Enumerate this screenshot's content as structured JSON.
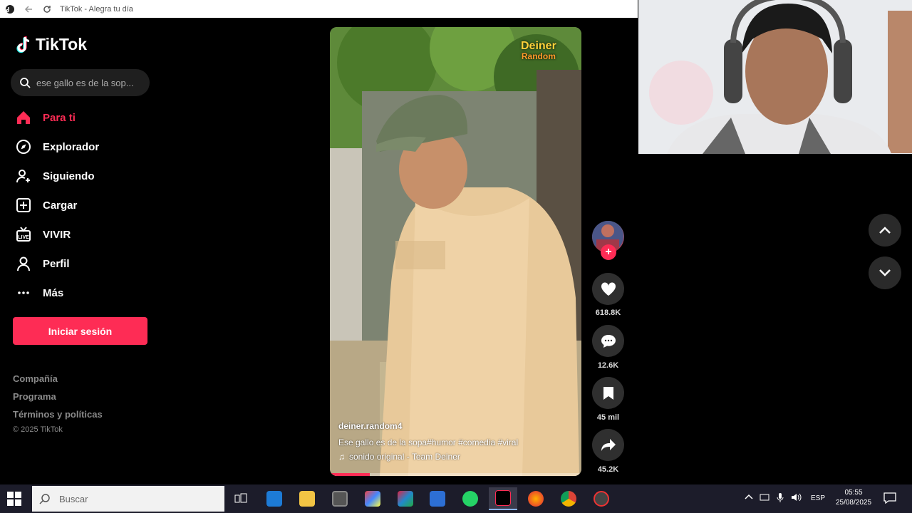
{
  "window": {
    "title": "TikTok - Alegra tu día"
  },
  "brand": {
    "name": "TikTok",
    "accent": "#fe2c55"
  },
  "search": {
    "value": "ese gallo es de la sop..."
  },
  "nav": {
    "items": [
      {
        "label": "Para ti",
        "icon": "home-icon",
        "active": true
      },
      {
        "label": "Explorador",
        "icon": "compass-icon"
      },
      {
        "label": "Siguiendo",
        "icon": "following-icon"
      },
      {
        "label": "Cargar",
        "icon": "upload-icon"
      },
      {
        "label": "VIVIR",
        "icon": "live-icon"
      },
      {
        "label": "Perfil",
        "icon": "profile-icon"
      },
      {
        "label": "Más",
        "icon": "more-icon"
      }
    ],
    "login_label": "Iniciar sesión"
  },
  "footer": {
    "links": [
      "Compañía",
      "Programa",
      "Términos y políticas"
    ],
    "copyright": "© 2025 TikTok"
  },
  "video": {
    "watermark_line1": "Deiner",
    "watermark_line2": "Random",
    "author": "deiner.random4",
    "caption": "Ese gallo es de la sopa#humor  #comedia  #viral",
    "sound": "sonido original - Team Deiner",
    "progress": 0.16
  },
  "actions": {
    "likes": "618.8K",
    "comments": "12.6K",
    "saves": "45 mil",
    "shares": "45.2K"
  },
  "taskbar": {
    "search_placeholder": "Buscar",
    "language": "ESP",
    "time": "05:55",
    "date": "25/08/2025"
  }
}
